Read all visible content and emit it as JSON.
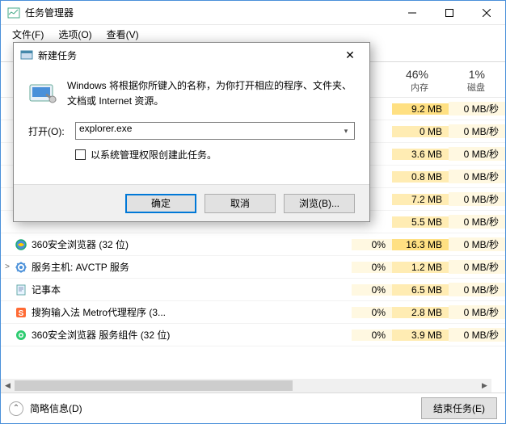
{
  "window": {
    "title": "任务管理器",
    "menu": {
      "file": "文件(F)",
      "options": "选项(O)",
      "view": "查看(V)"
    }
  },
  "columns": {
    "mem_pct": "46%",
    "mem_lbl": "内存",
    "disk_pct": "1%",
    "disk_lbl": "磁盘"
  },
  "rows": [
    {
      "expand": "",
      "name": "",
      "cpu": "",
      "mem": "9.2 MB",
      "disk": "0 MB/秒",
      "memhot": true
    },
    {
      "expand": "",
      "name": "",
      "cpu": "",
      "mem": "0 MB",
      "disk": "0 MB/秒"
    },
    {
      "expand": "",
      "name": "",
      "cpu": "",
      "mem": "3.6 MB",
      "disk": "0 MB/秒"
    },
    {
      "expand": "",
      "name": "",
      "cpu": "",
      "mem": "0.8 MB",
      "disk": "0 MB/秒"
    },
    {
      "expand": "",
      "name": "",
      "cpu": "",
      "mem": "7.2 MB",
      "disk": "0 MB/秒"
    },
    {
      "expand": "",
      "name": "",
      "cpu": "",
      "mem": "5.5 MB",
      "disk": "0 MB/秒"
    },
    {
      "expand": "",
      "icon": "ie",
      "name": "360安全浏览器 (32 位)",
      "cpu": "0%",
      "mem": "16.3 MB",
      "disk": "0 MB/秒",
      "memhot": true
    },
    {
      "expand": ">",
      "icon": "svc",
      "name": "服务主机: AVCTP 服务",
      "cpu": "0%",
      "mem": "1.2 MB",
      "disk": "0 MB/秒"
    },
    {
      "expand": "",
      "icon": "note",
      "name": "记事本",
      "cpu": "0%",
      "mem": "6.5 MB",
      "disk": "0 MB/秒"
    },
    {
      "expand": "",
      "icon": "sogou",
      "name": "搜狗输入法 Metro代理程序 (3...",
      "cpu": "0%",
      "mem": "2.8 MB",
      "disk": "0 MB/秒"
    },
    {
      "expand": "",
      "icon": "360",
      "name": "360安全浏览器 服务组件 (32 位)",
      "cpu": "0%",
      "mem": "3.9 MB",
      "disk": "0 MB/秒"
    }
  ],
  "footer": {
    "brief": "简略信息(D)",
    "end_task": "结束任务(E)"
  },
  "dialog": {
    "title": "新建任务",
    "desc": "Windows 将根据你所键入的名称，为你打开相应的程序、文件夹、文档或 Internet 资源。",
    "open_label": "打开(O):",
    "input_value": "explorer.exe",
    "admin_check": "以系统管理权限创建此任务。",
    "ok": "确定",
    "cancel": "取消",
    "browse": "浏览(B)..."
  }
}
